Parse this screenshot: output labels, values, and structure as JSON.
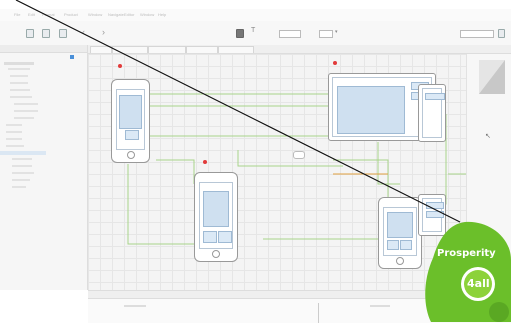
{
  "colors": {
    "accent_green": "#8bc34a",
    "segue_line": "#a8d48a",
    "screen_blue": "#cfe0f0",
    "pin_red": "#e23b3b",
    "logo_green": "#6bbf2a"
  },
  "menubar": {
    "items": [
      "File",
      "Edit",
      "Format",
      "Product",
      "Window",
      "Navigate",
      "Editor",
      "Window",
      "Help"
    ]
  },
  "toolbar": {
    "icons": [
      "back-icon",
      "forward-icon",
      "run-icon",
      "stop-icon",
      "scheme-selector",
      "library-icon"
    ]
  },
  "logo": {
    "word": "Prosperity",
    "badge": "4all"
  }
}
